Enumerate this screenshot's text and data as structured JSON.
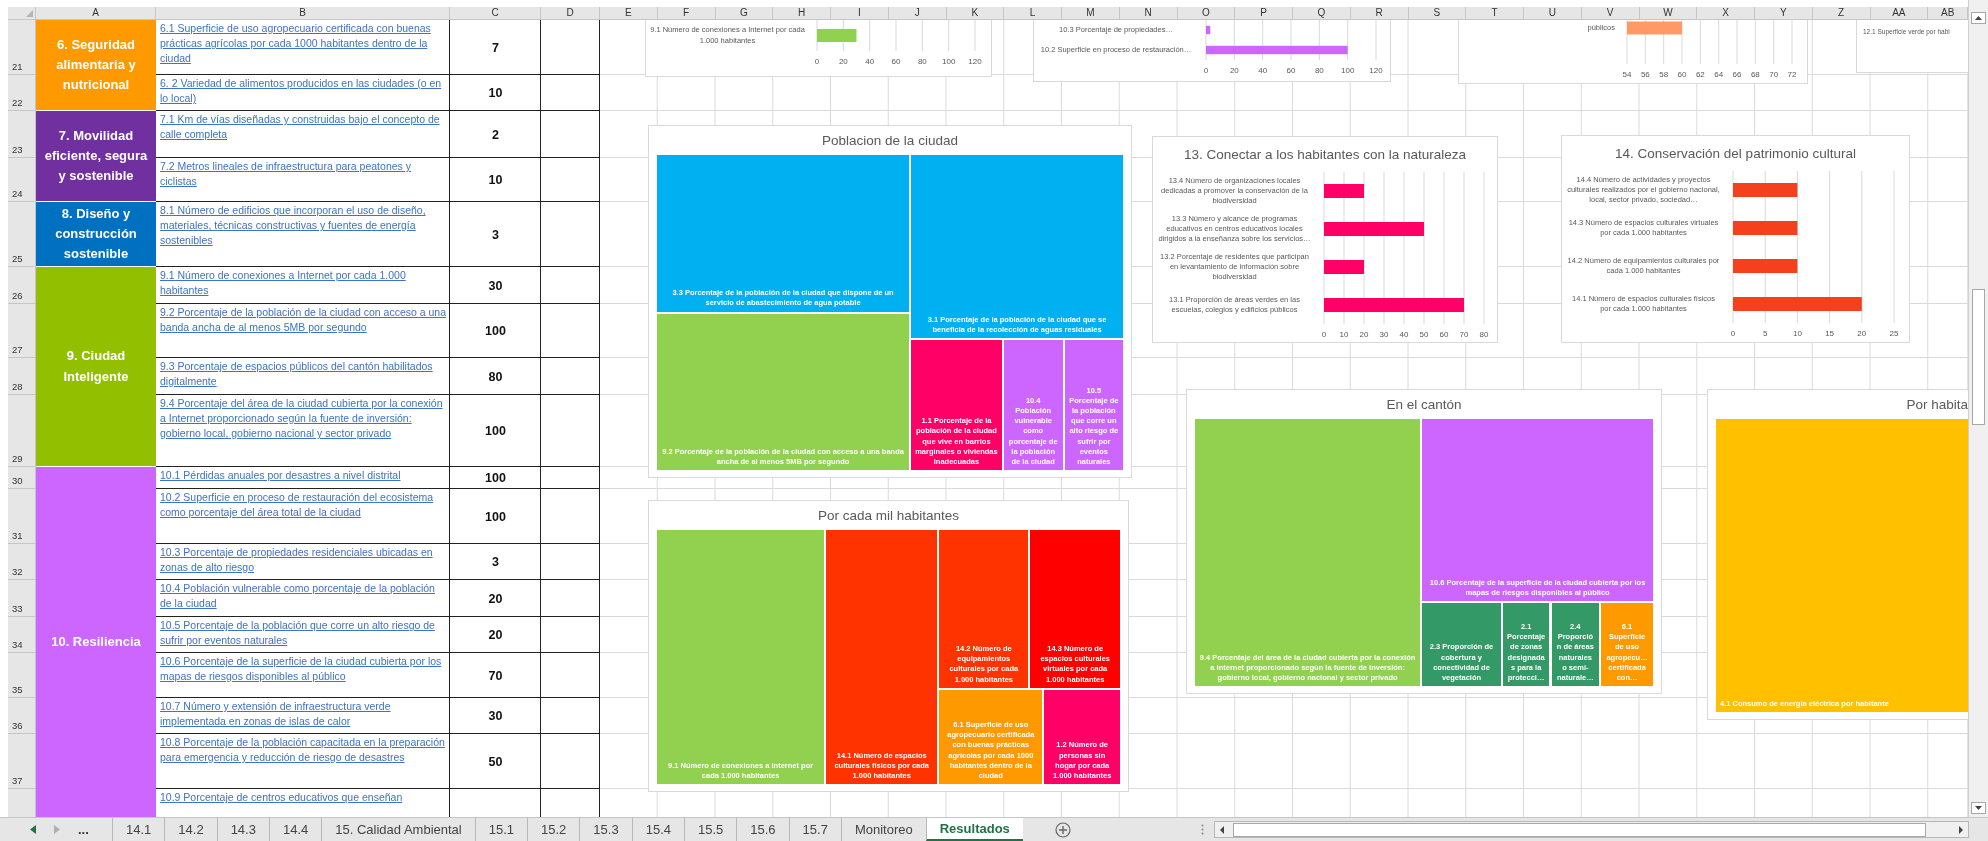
{
  "columns": [
    "A",
    "B",
    "C",
    "D",
    "E",
    "F",
    "G",
    "H",
    "I",
    "J",
    "K",
    "L",
    "M",
    "N",
    "O",
    "P",
    "Q",
    "R",
    "S",
    "T",
    "U",
    "V",
    "W",
    "X",
    "Y",
    "Z",
    "AA",
    "AB"
  ],
  "row_numbers": [
    "21",
    "22",
    "23",
    "24",
    "25",
    "26",
    "27",
    "28",
    "29",
    "30",
    "31",
    "32",
    "33",
    "34",
    "35",
    "36",
    "37"
  ],
  "categories": [
    {
      "label": "6. Seguridad alimentaria y nutricional",
      "color": "#ff9900",
      "indicators": [
        {
          "text": "6.1 Superficie de uso agropecuario certificada con buenas prácticas agrícolas por cada 1000 habitantes dentro de la ciudad",
          "value": "7"
        },
        {
          "text": "6. 2 Variedad de alimentos producidos en las ciudades (o en lo local)",
          "value": "10"
        }
      ]
    },
    {
      "label": "7. Movilidad eficiente, segura y sostenible",
      "color": "#7030a0",
      "indicators": [
        {
          "text": "7.1 Km de vías diseñadas y construidas bajo el concepto de calle completa",
          "value": "2"
        },
        {
          "text": "7.2 Metros lineales de infraestructura para peatones y ciclistas",
          "value": "10"
        }
      ]
    },
    {
      "label": "8. Diseño y construcción sostenible",
      "color": "#0070c0",
      "indicators": [
        {
          "text": "8.1 Número de edificios que incorporan el uso de diseño, materiales, técnicas constructivas y fuentes de energía sostenibles",
          "value": "3"
        }
      ]
    },
    {
      "label": "9. Ciudad Inteligente",
      "color": "#92c000",
      "indicators": [
        {
          "text": "9.1 Número de conexiones a Internet por cada 1.000 habitantes",
          "value": "30"
        },
        {
          "text": "9.2 Porcentaje de la población de la ciudad con acceso a una banda ancha de al menos 5MB por segundo",
          "value": "100"
        },
        {
          "text": "9.3 Porcentaje de espacios públicos del cantón habilitados digitalmente",
          "value": "80"
        },
        {
          "text": "9.4 Porcentaje del área de la ciudad cubierta por la conexión a Internet proporcionado según la fuente de inversión: gobierno local, gobierno nacional y sector privado",
          "value": "100"
        }
      ]
    },
    {
      "label": "10. Resiliencia",
      "color": "#cc66ff",
      "indicators": [
        {
          "text": "10.1 Pérdidas anuales por desastres a nivel distrital",
          "value": "100"
        },
        {
          "text": "10.2 Superficie en proceso de restauración del ecosistema como porcentaje del área total de la ciudad",
          "value": "100"
        },
        {
          "text": "10.3 Porcentaje de propiedades residenciales ubicadas en zonas de alto riesgo",
          "value": "3"
        },
        {
          "text": "10.4 Población vulnerable como porcentaje de la población de la ciudad",
          "value": "20"
        },
        {
          "text": "10.5 Porcentaje de la población que corre un alto riesgo de sufrir por eventos naturales",
          "value": "20"
        },
        {
          "text": "10.6 Porcentaje de la superficie de la ciudad cubierta por los mapas de riesgos disponibles al público",
          "value": "70"
        },
        {
          "text": "10.7 Número y extensión de infraestructura verde implementada en zonas de islas de calor",
          "value": "30"
        },
        {
          "text": "10.8 Porcentaje de la población capacitada en la preparación para emergencia y reducción de riesgo de desastres",
          "value": "50"
        },
        {
          "text": "10.9 Porcentaje de centros educativos que enseñan"
        }
      ]
    }
  ],
  "charts": [
    {
      "kind": "bar",
      "chart_data": {
        "type": "bar",
        "orientation": "horizontal",
        "categories": [
          "9.1 Número de conexiones a Internet por cada 1.000 habitantes"
        ],
        "series": [
          {
            "color": "#92d050",
            "values": [
              30
            ]
          }
        ],
        "xlim": [
          0,
          120
        ],
        "xticks": [
          0,
          20,
          40,
          60,
          80,
          100,
          120
        ],
        "grid": true
      }
    },
    {
      "kind": "bar",
      "chart_data": {
        "type": "bar",
        "orientation": "horizontal",
        "categories": [
          "10.3 Porcentaje de propiedades…",
          "10.2 Superficie en proceso de restauración…"
        ],
        "series": [
          {
            "color": "#cc66ff",
            "values": [
              3,
              100
            ]
          }
        ],
        "xlim": [
          0,
          120
        ],
        "xticks": [
          0,
          20,
          40,
          60,
          80,
          100,
          120
        ],
        "grid": true
      }
    },
    {
      "kind": "bar",
      "chart_data": {
        "type": "bar",
        "orientation": "horizontal",
        "categories": [
          "públicos"
        ],
        "series": [
          {
            "color": "#ff9966",
            "values": [
              60
            ]
          }
        ],
        "xlim": [
          54,
          72
        ],
        "xticks": [
          54,
          56,
          58,
          60,
          62,
          64,
          66,
          68,
          70,
          72
        ],
        "grid": true
      }
    },
    {
      "kind": "label",
      "text": "12.1 Superficie verde por habi"
    },
    {
      "kind": "treemap",
      "title": "Poblacion de la ciudad",
      "tiles": [
        {
          "label": "3.3 Porcentaje de la población de la ciudad que dispone de un servicio de abastecimiento de agua potable",
          "color": "#00b0f0"
        },
        {
          "label": "3.1 Porcentaje de la población de la ciudad que se beneficia de la recolección de aguas residuales",
          "color": "#00b0f0"
        },
        {
          "label": "9.2 Porcentaje de la población de la ciudad con acceso a una banda ancha de al menos 5MB por segundo",
          "color": "#92d050"
        },
        {
          "label": "1.1 Porcentaje de la población de la ciudad que vive en barrios marginales o viviendas inadecuadas",
          "color": "#ff0066"
        },
        {
          "label": "10.4 Población vulnerable como porcentaje de la población de la ciudad",
          "color": "#cc66ff"
        },
        {
          "label": "10.5 Porcentaje de la población que corre un alto riesgo de sufrir por eventos naturales",
          "color": "#cc66ff"
        }
      ]
    },
    {
      "kind": "bar",
      "chart_data": {
        "type": "bar",
        "orientation": "horizontal",
        "title": "13. Conectar a los habitantes con la naturaleza",
        "categories": [
          "13.4 Número de organizaciones locales dedicadas a promover la conservación de la biodiversidad",
          "13.3 Número y alcance de programas educativos en centros educativos locales dirigidos a la enseñanza sobre los servicios…",
          "13.2 Porcentaje de residentes que participan en levantamiento de información sobre biodiversidad",
          "13.1 Proporción de áreas verdes en las escuelas, colegios y edificios públicos"
        ],
        "series": [
          {
            "color": "#ff0066",
            "values": [
              20,
              50,
              20,
              70
            ]
          }
        ],
        "xlim": [
          0,
          80
        ],
        "xticks": [
          0,
          10,
          20,
          30,
          40,
          50,
          60,
          70,
          80
        ],
        "grid": true
      }
    },
    {
      "kind": "bar",
      "chart_data": {
        "type": "bar",
        "orientation": "horizontal",
        "title": "14. Conservación del patrimonio cultural",
        "categories": [
          "14.4 Número de actividades y proyectos culturales realizados por el gobierno nacional, local, sector privado, sociedad…",
          "14.3 Número de espacios culturales virtuales por cada 1.000 habitantes",
          "14.2 Número de equipamientos culturales por cada 1.000 habitantes",
          "14.1 Número de espacios culturales físicos por cada 1.000 habitantes"
        ],
        "series": [
          {
            "color": "#f4401c",
            "values": [
              10,
              10,
              10,
              20
            ]
          }
        ],
        "xlim": [
          0,
          25
        ],
        "xticks": [
          0,
          5,
          10,
          15,
          20,
          25
        ],
        "grid": true
      }
    },
    {
      "kind": "treemap",
      "title": "En el cantón",
      "tiles": [
        {
          "label": "9.4 Porcentaje del área de la ciudad cubierta por la conexión a Internet proporcionado según la fuente de inversión: gobierno local, gobierno nacional y sector privado",
          "color": "#92d050"
        },
        {
          "label": "10.6 Porcentaje de la superficie de la ciudad cubierta por los mapas de riesgos disponibles al público",
          "color": "#cc66ff"
        },
        {
          "label": "2.3 Proporción de cobertura y conectividad de vegetación",
          "color": "#339966"
        },
        {
          "label": "2.1 Porcentaje de zonas designadas para la protecci…",
          "color": "#339966"
        },
        {
          "label": "2.4 Proporción de áreas naturales o semi-naturale…",
          "color": "#339966"
        },
        {
          "label": "6.1 Superficie de uso agropecu… certificada con…",
          "color": "#ff9900"
        }
      ]
    },
    {
      "kind": "treemap",
      "title": "Por habita",
      "tiles": [
        {
          "label": "4.1 Consumo de energía eléctrica por habitante",
          "color": "#ffc000"
        }
      ]
    },
    {
      "kind": "treemap",
      "title": "Por cada mil habitantes",
      "tiles": [
        {
          "label": "9.1 Número de conexiones a Internet por cada 1.000 habitantes",
          "color": "#92d050"
        },
        {
          "label": "14.1 Número de espacios culturales físicos por cada 1.000 habitantes",
          "color": "#ff3300"
        },
        {
          "label": "14.2 Número de equipamientos culturales por cada 1.000 habitantes",
          "color": "#ff3300"
        },
        {
          "label": "14.3 Número de espacios culturales virtuales por cada 1.000 habitantes",
          "color": "#ff0000"
        },
        {
          "label": "6.1 Superficie de uso agropecuario certificada con buenas prácticas agrícolas por cada 1000 habitantes dentro de la ciudad",
          "color": "#ff9900"
        },
        {
          "label": "1.2 Número de personas sin hogar por cada 1.000 habitantes",
          "color": "#ff0066"
        }
      ]
    }
  ],
  "tab_overflow": "...",
  "sheet_tabs": [
    {
      "label": "14.1",
      "selected": false
    },
    {
      "label": "14.2",
      "selected": false
    },
    {
      "label": "14.3",
      "selected": false
    },
    {
      "label": "14.4",
      "selected": false
    },
    {
      "label": "15. Calidad Ambiental",
      "selected": false
    },
    {
      "label": "15.1",
      "selected": false
    },
    {
      "label": "15.2",
      "selected": false
    },
    {
      "label": "15.3",
      "selected": false
    },
    {
      "label": "15.4",
      "selected": false
    },
    {
      "label": "15.5",
      "selected": false
    },
    {
      "label": "15.6",
      "selected": false
    },
    {
      "label": "15.7",
      "selected": false
    },
    {
      "label": "Monitoreo",
      "selected": false
    },
    {
      "label": "Resultados",
      "selected": true
    }
  ]
}
